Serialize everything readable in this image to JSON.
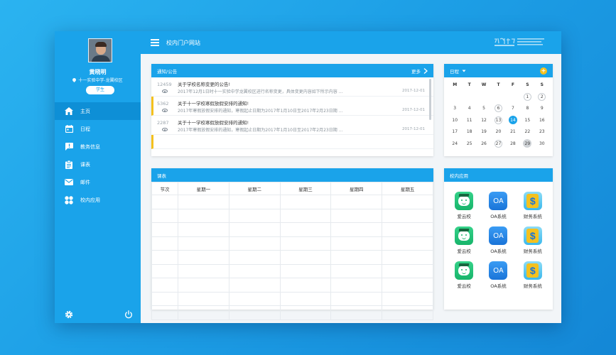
{
  "user": {
    "name": "黄晓明",
    "school": "十一实验中学-龙翼校区",
    "role": "学生"
  },
  "sidebar": {
    "items": [
      {
        "label": "主页",
        "icon": "home-icon",
        "active": true
      },
      {
        "label": "日程",
        "icon": "calendar-icon",
        "active": false
      },
      {
        "label": "教务信息",
        "icon": "alert-icon",
        "active": false
      },
      {
        "label": "课表",
        "icon": "clipboard-icon",
        "active": false
      },
      {
        "label": "邮件",
        "icon": "mail-icon",
        "active": false
      },
      {
        "label": "校内应用",
        "icon": "apps-icon",
        "active": false
      }
    ]
  },
  "topbar": {
    "title": "校内门户网站"
  },
  "notices": {
    "title": "通知/公告",
    "more": "更多",
    "items": [
      {
        "count": "12459",
        "title": "关于学校名称变更的公告!",
        "desc": "2017年12月1日时十一实验中学龙翼校区进行名称变更，具体变更内容如下所示内容 ...",
        "date": "2017-12-01"
      },
      {
        "count": "5362",
        "title": "关于十一学校寒假放假安排的通知!",
        "desc": "2017年寒假放假安排的通知，寒假起止日期为2017年1月10日至2017年2月23日期 ...",
        "date": "2017-12-01"
      },
      {
        "count": "2287",
        "title": "关于十一学校寒假放假安排的通知!",
        "desc": "2017年寒假放假安排的通知，寒假起止日期为2017年1月10日至2017年2月23日期 ...",
        "date": "2017-12-01"
      }
    ]
  },
  "calendar": {
    "title": "日程",
    "weekdays": [
      "M",
      "T",
      "W",
      "T",
      "F",
      "S",
      "S"
    ],
    "days": [
      "",
      "",
      "",
      "",
      "",
      "1",
      "2",
      "3",
      "4",
      "5",
      "6",
      "7",
      "8",
      "9",
      "10",
      "11",
      "12",
      "13",
      "14",
      "15",
      "16",
      "17",
      "18",
      "19",
      "20",
      "21",
      "22",
      "23",
      "24",
      "25",
      "26",
      "27",
      "28",
      "29",
      "30"
    ],
    "marked_days": [
      "1",
      "2",
      "6",
      "13",
      "27"
    ],
    "today": "14",
    "selected_day": "29"
  },
  "schedule": {
    "title": "课表",
    "columns": [
      "节次",
      "星期一",
      "星期二",
      "星期三",
      "星期四",
      "星期五"
    ],
    "row_count": 9
  },
  "apps": {
    "title": "校内应用",
    "items": [
      {
        "label": "爱云校",
        "icon": "aiyunxiao-icon"
      },
      {
        "label": "OA系统",
        "icon": "oa-icon"
      },
      {
        "label": "财务系统",
        "icon": "finance-icon"
      },
      {
        "label": "爱云校",
        "icon": "aiyunxiao-icon"
      },
      {
        "label": "OA系统",
        "icon": "oa-icon"
      },
      {
        "label": "财务系统",
        "icon": "finance-icon"
      },
      {
        "label": "爱云校",
        "icon": "aiyunxiao-icon"
      },
      {
        "label": "OA系统",
        "icon": "oa-icon"
      },
      {
        "label": "财务系统",
        "icon": "finance-icon"
      }
    ],
    "oa_glyph": "OA",
    "finance_glyph": "$"
  },
  "colors": {
    "primary": "#1aa3ea",
    "active_menu": "#0e8fd6",
    "accent": "#f4c11e"
  }
}
